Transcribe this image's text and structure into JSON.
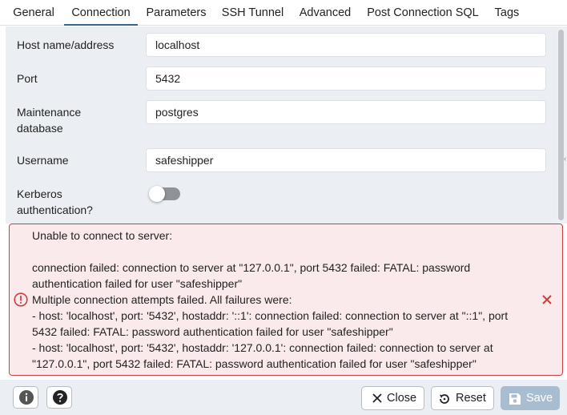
{
  "tabs": [
    {
      "label": "General"
    },
    {
      "label": "Connection",
      "active": true
    },
    {
      "label": "Parameters"
    },
    {
      "label": "SSH Tunnel"
    },
    {
      "label": "Advanced"
    },
    {
      "label": "Post Connection SQL"
    },
    {
      "label": "Tags"
    }
  ],
  "form": {
    "host": {
      "label": "Host name/address",
      "value": "localhost"
    },
    "port": {
      "label": "Port",
      "value": "5432"
    },
    "maintenance_db": {
      "label_line1": "Maintenance",
      "label_line2": "database",
      "value": "postgres"
    },
    "username": {
      "label": "Username",
      "value": "safeshipper"
    },
    "kerberos": {
      "label_line1": "Kerberos",
      "label_line2": "authentication?",
      "enabled": false
    }
  },
  "error": {
    "message": "Unable to connect to server:\n\nconnection failed: connection to server at \"127.0.0.1\", port 5432 failed: FATAL: password authentication failed for user \"safeshipper\"\nMultiple connection attempts failed. All failures were:\n- host: 'localhost', port: '5432', hostaddr: '::1': connection failed: connection to server at \"::1\", port 5432 failed: FATAL: password authentication failed for user \"safeshipper\"\n- host: 'localhost', port: '5432', hostaddr: '127.0.0.1': connection failed: connection to server at \"127.0.0.1\", port 5432 failed: FATAL: password authentication failed for user \"safeshipper\"",
    "icon": "error-circle-icon",
    "color": "#ce3e3e"
  },
  "footer": {
    "info_icon": "info-icon",
    "help_icon": "help-icon",
    "close_label": "Close",
    "reset_label": "Reset",
    "save_label": "Save"
  },
  "colors": {
    "accent": "#326690",
    "error": "#ce3e3e",
    "save_disabled": "#a9bdd0"
  }
}
